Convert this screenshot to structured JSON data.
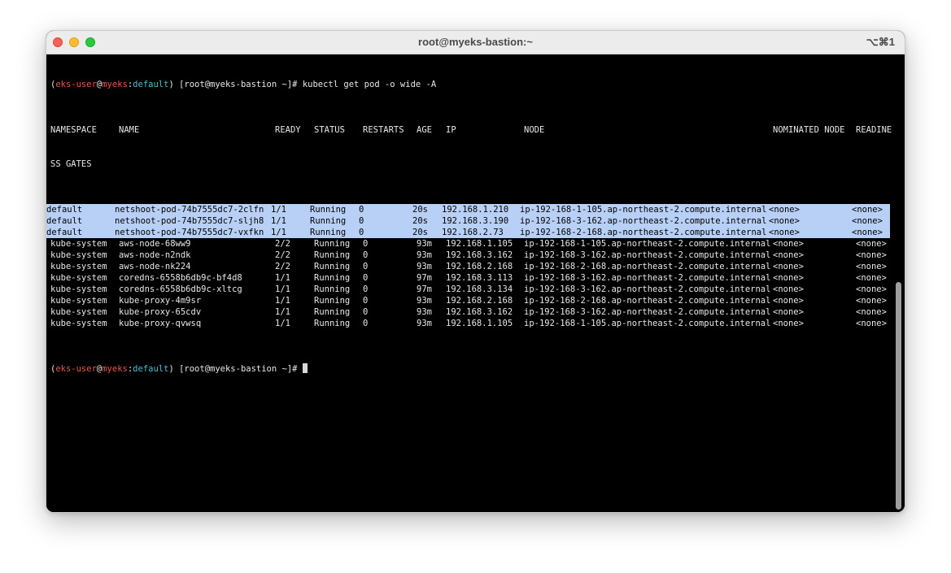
{
  "window": {
    "title": "root@myeks-bastion:~",
    "shortcut": "⌥⌘1"
  },
  "prompt": {
    "user": "eks-user",
    "at": "@",
    "host": "myeks",
    "colon": ":",
    "context": "default",
    "tail": "[root@myeks-bastion ~]# "
  },
  "command": "kubectl get pod -o wide -A",
  "headers": {
    "namespace": "NAMESPACE",
    "name": "NAME",
    "ready": "READY",
    "status": "STATUS",
    "restarts": "RESTARTS",
    "age": "AGE",
    "ip": "IP",
    "node": "NODE",
    "nominated": "NOMINATED NODE",
    "readiness": "READINE",
    "readiness_wrap": "SS GATES"
  },
  "rows": [
    {
      "ns": "default",
      "name": "netshoot-pod-74b7555dc7-2clfn",
      "ready": "1/1",
      "status": "Running",
      "restarts": "0",
      "age": "20s",
      "ip": "192.168.1.210",
      "node": "ip-192-168-1-105.ap-northeast-2.compute.internal",
      "nom": "<none>",
      "rg": "<none>",
      "selected": true
    },
    {
      "ns": "default",
      "name": "netshoot-pod-74b7555dc7-sljh8",
      "ready": "1/1",
      "status": "Running",
      "restarts": "0",
      "age": "20s",
      "ip": "192.168.3.190",
      "node": "ip-192-168-3-162.ap-northeast-2.compute.internal",
      "nom": "<none>",
      "rg": "<none>",
      "selected": true
    },
    {
      "ns": "default",
      "name": "netshoot-pod-74b7555dc7-vxfkn",
      "ready": "1/1",
      "status": "Running",
      "restarts": "0",
      "age": "20s",
      "ip": "192.168.2.73",
      "node": "ip-192-168-2-168.ap-northeast-2.compute.internal",
      "nom": "<none>",
      "rg": "<none>",
      "selected": true
    },
    {
      "ns": "kube-system",
      "name": "aws-node-68ww9",
      "ready": "2/2",
      "status": "Running",
      "restarts": "0",
      "age": "93m",
      "ip": "192.168.1.105",
      "node": "ip-192-168-1-105.ap-northeast-2.compute.internal",
      "nom": "<none>",
      "rg": "<none>",
      "selected": false
    },
    {
      "ns": "kube-system",
      "name": "aws-node-n2ndk",
      "ready": "2/2",
      "status": "Running",
      "restarts": "0",
      "age": "93m",
      "ip": "192.168.3.162",
      "node": "ip-192-168-3-162.ap-northeast-2.compute.internal",
      "nom": "<none>",
      "rg": "<none>",
      "selected": false
    },
    {
      "ns": "kube-system",
      "name": "aws-node-nk224",
      "ready": "2/2",
      "status": "Running",
      "restarts": "0",
      "age": "93m",
      "ip": "192.168.2.168",
      "node": "ip-192-168-2-168.ap-northeast-2.compute.internal",
      "nom": "<none>",
      "rg": "<none>",
      "selected": false
    },
    {
      "ns": "kube-system",
      "name": "coredns-6558b6db9c-bf4d8",
      "ready": "1/1",
      "status": "Running",
      "restarts": "0",
      "age": "97m",
      "ip": "192.168.3.113",
      "node": "ip-192-168-3-162.ap-northeast-2.compute.internal",
      "nom": "<none>",
      "rg": "<none>",
      "selected": false
    },
    {
      "ns": "kube-system",
      "name": "coredns-6558b6db9c-xltcg",
      "ready": "1/1",
      "status": "Running",
      "restarts": "0",
      "age": "97m",
      "ip": "192.168.3.134",
      "node": "ip-192-168-3-162.ap-northeast-2.compute.internal",
      "nom": "<none>",
      "rg": "<none>",
      "selected": false
    },
    {
      "ns": "kube-system",
      "name": "kube-proxy-4m9sr",
      "ready": "1/1",
      "status": "Running",
      "restarts": "0",
      "age": "93m",
      "ip": "192.168.2.168",
      "node": "ip-192-168-2-168.ap-northeast-2.compute.internal",
      "nom": "<none>",
      "rg": "<none>",
      "selected": false
    },
    {
      "ns": "kube-system",
      "name": "kube-proxy-65cdv",
      "ready": "1/1",
      "status": "Running",
      "restarts": "0",
      "age": "93m",
      "ip": "192.168.3.162",
      "node": "ip-192-168-3-162.ap-northeast-2.compute.internal",
      "nom": "<none>",
      "rg": "<none>",
      "selected": false
    },
    {
      "ns": "kube-system",
      "name": "kube-proxy-qvwsq",
      "ready": "1/1",
      "status": "Running",
      "restarts": "0",
      "age": "93m",
      "ip": "192.168.1.105",
      "node": "ip-192-168-1-105.ap-northeast-2.compute.internal",
      "nom": "<none>",
      "rg": "<none>",
      "selected": false
    }
  ],
  "colors": {
    "selection": "#b8d0f5",
    "prompt_user": "#e85a4f",
    "prompt_context": "#46c2d3"
  }
}
